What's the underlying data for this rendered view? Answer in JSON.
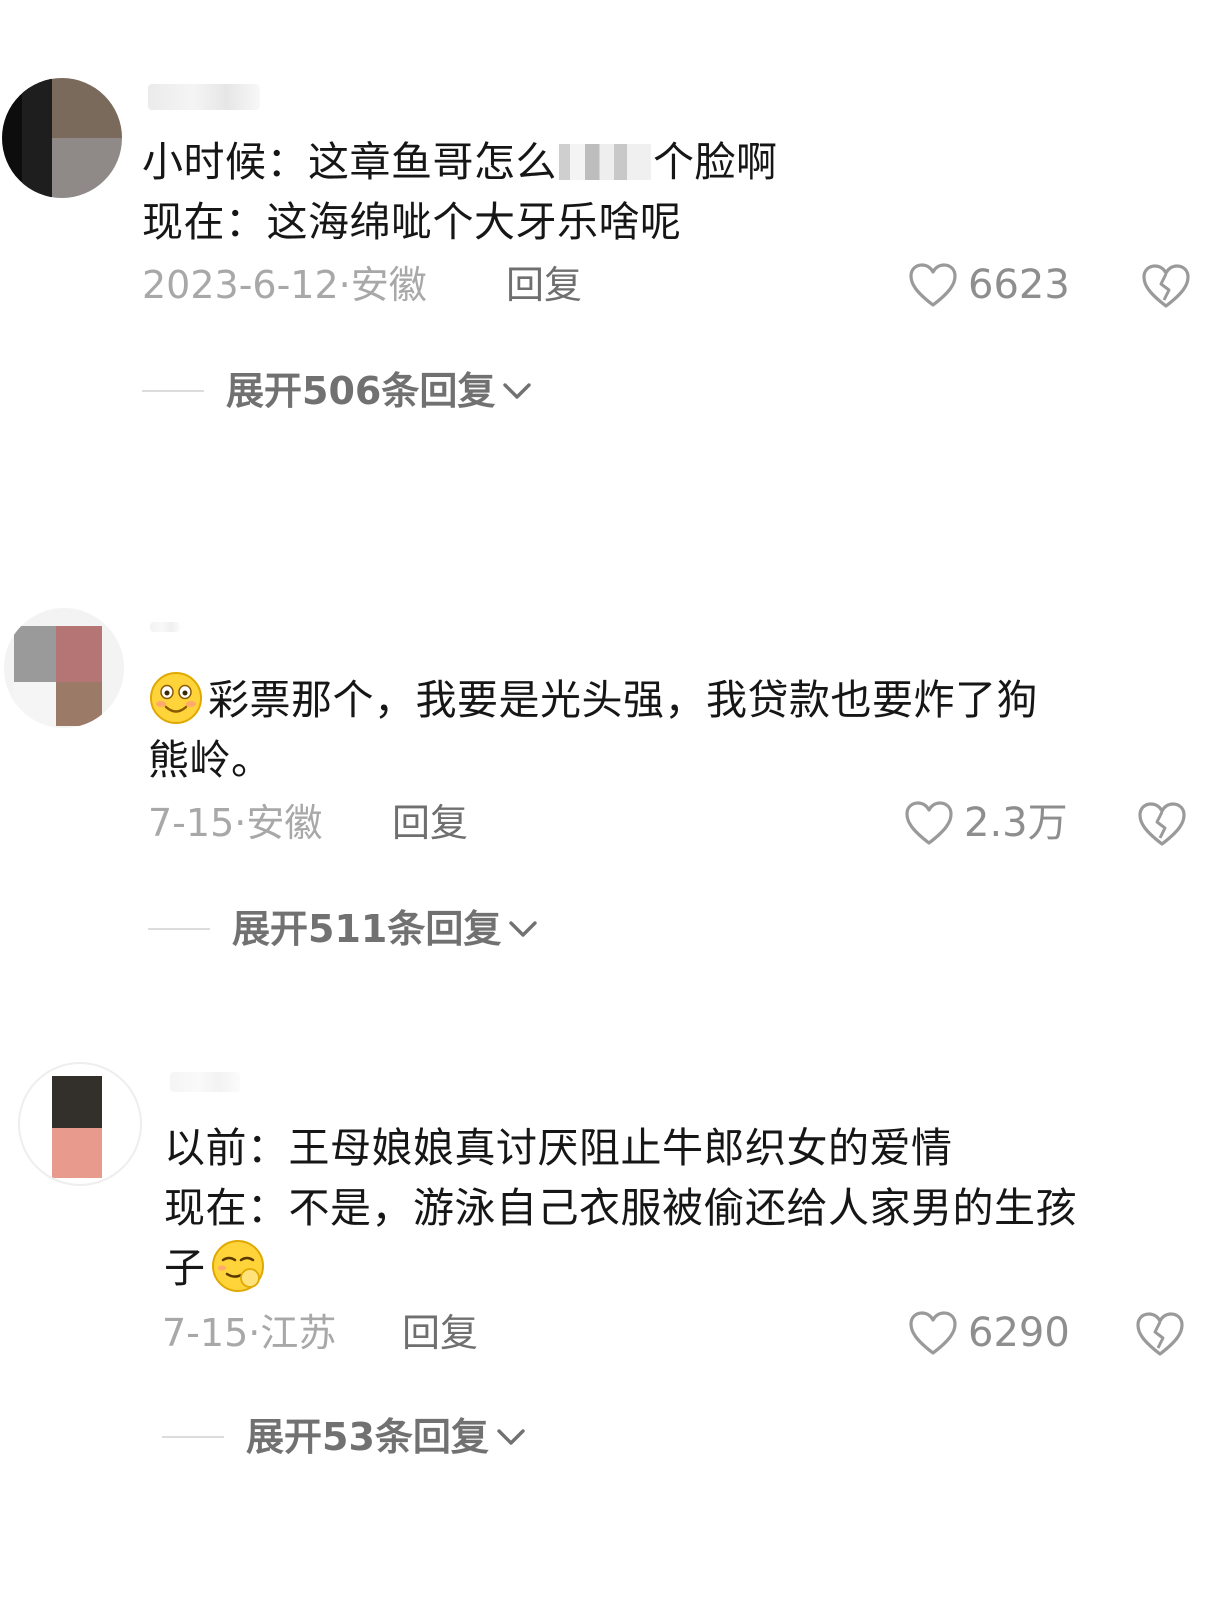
{
  "comments": [
    {
      "lines": [
        "小时候：这章鱼哥怎么",
        "个脸啊",
        "现在：这海绵呲个大牙乐啥呢"
      ],
      "date": "2023-6-12",
      "location": "安徽",
      "meta_sep": "·",
      "reply_label": "回复",
      "likes": "6623",
      "expand_label": "展开506条回复"
    },
    {
      "lines": [
        "彩票那个，我要是光头强，我贷款也要炸了狗",
        "熊岭。"
      ],
      "date": "7-15",
      "location": "安徽",
      "meta_sep": "·",
      "reply_label": "回复",
      "likes": "2.3万",
      "expand_label": "展开511条回复"
    },
    {
      "lines": [
        "以前：王母娘娘真讨厌阻止牛郎织女的爱情",
        "现在：不是，游泳自己衣服被偷还给人家男的生孩",
        "子"
      ],
      "date": "7-15",
      "location": "江苏",
      "meta_sep": "·",
      "reply_label": "回复",
      "likes": "6290",
      "expand_label": "展开53条回复"
    }
  ],
  "icons": {
    "like": "heart-outline-icon",
    "dislike": "broken-heart-icon",
    "expand": "chevron-down-icon",
    "emoji_1": "smiling-face-emoji",
    "emoji_2": "smirking-face-emoji"
  },
  "colors": {
    "text": "#161616",
    "meta": "#a8a8a8",
    "action": "#6f6f6f",
    "icon": "#9a9a9a"
  }
}
